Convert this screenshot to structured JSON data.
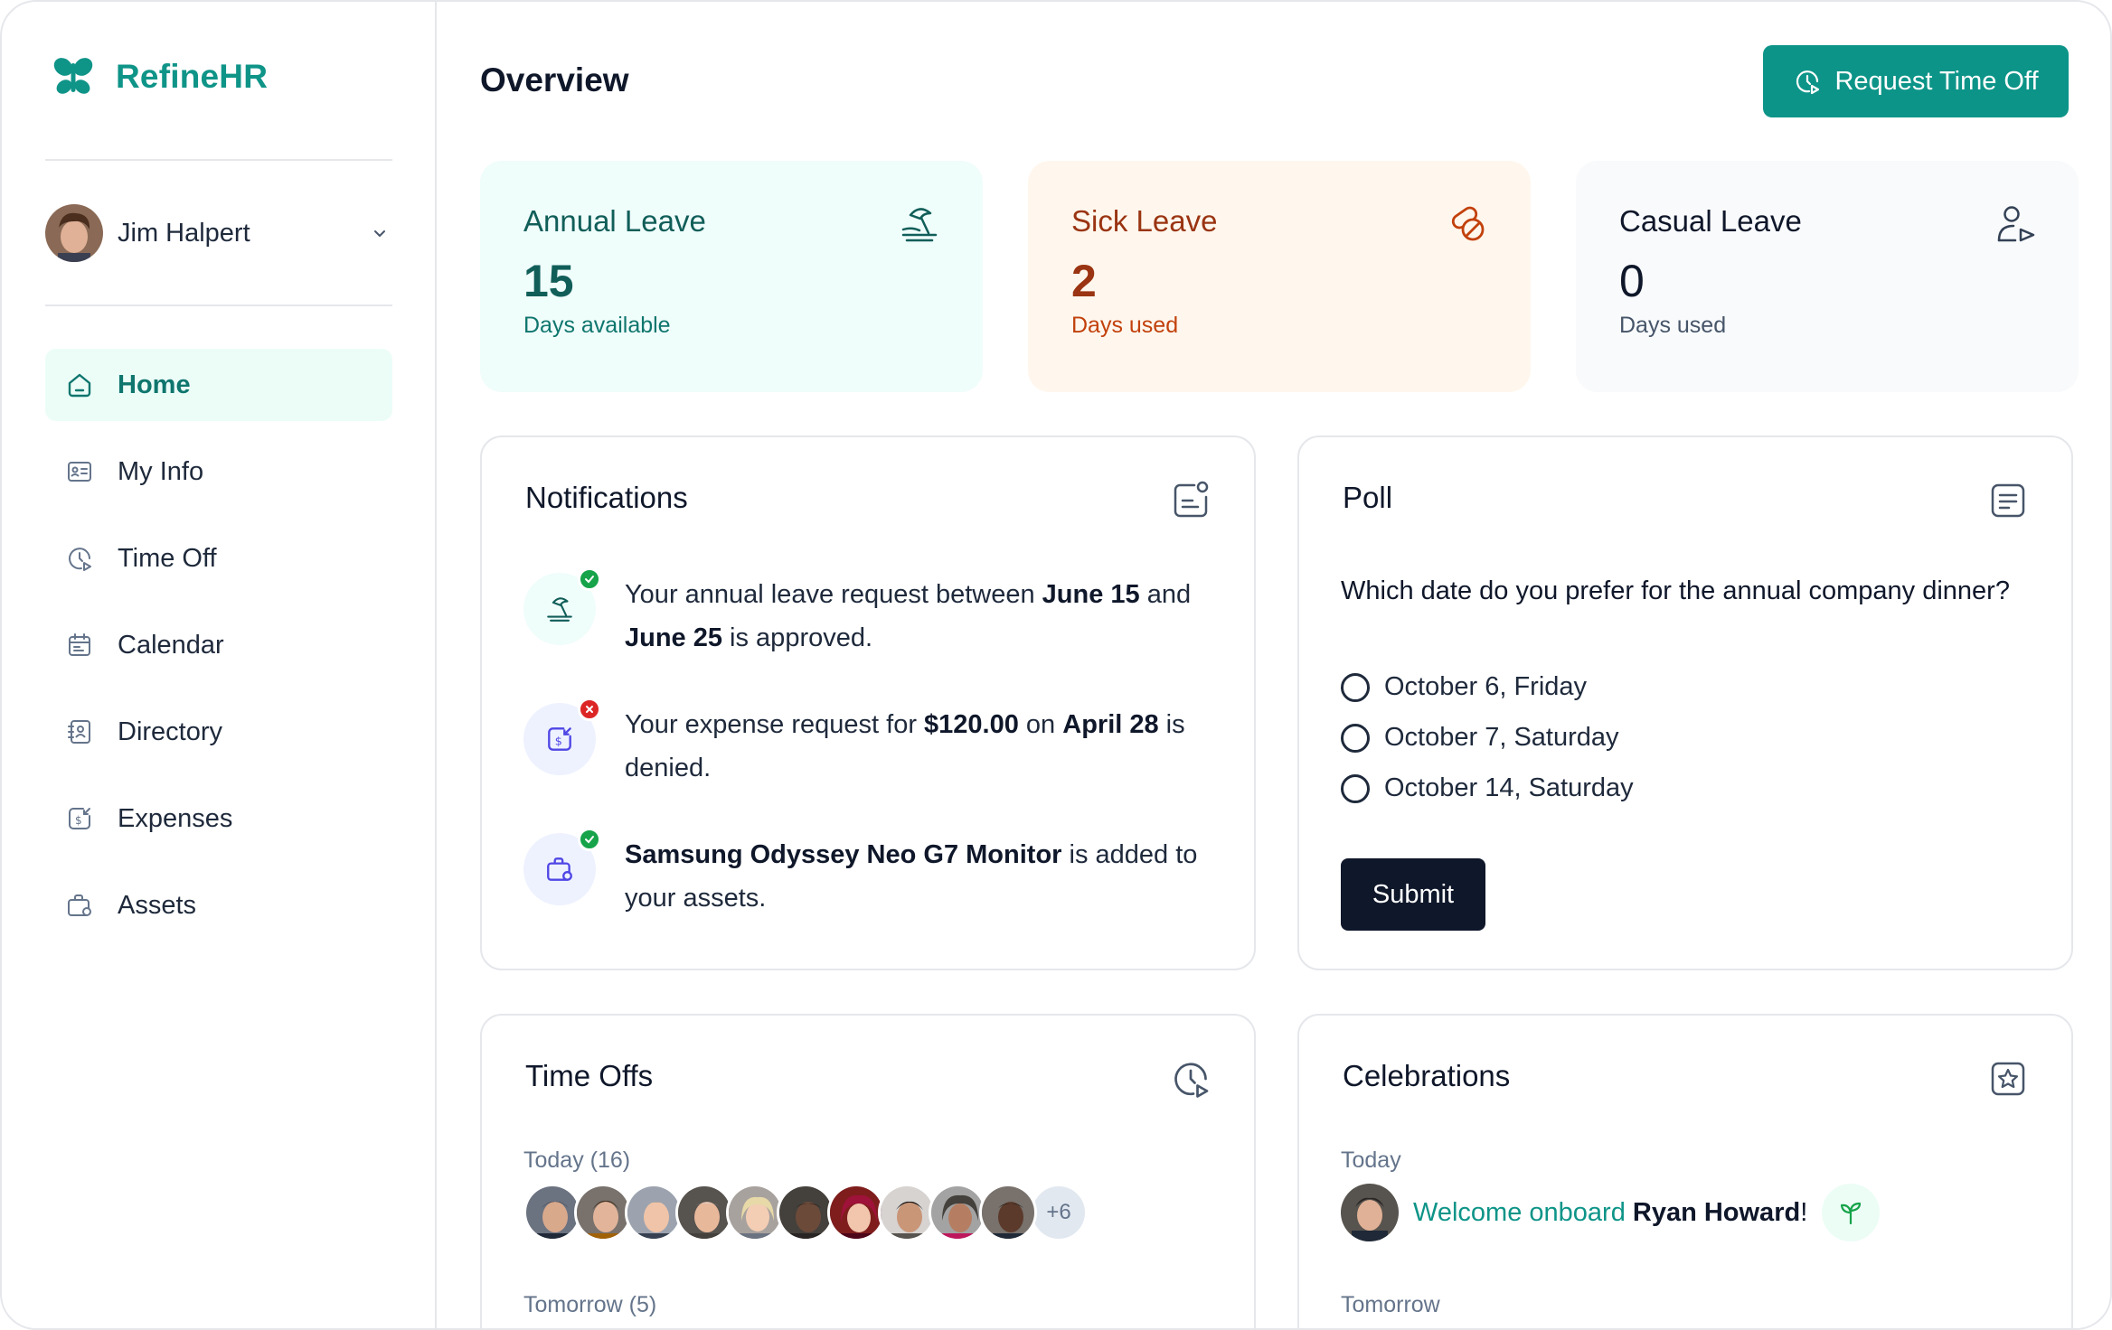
{
  "brand": {
    "name": "RefineHR",
    "color": "#0f9488"
  },
  "user": {
    "name": "Jim Halpert"
  },
  "nav": [
    {
      "label": "Home",
      "icon": "home-icon",
      "active": true
    },
    {
      "label": "My Info",
      "icon": "id-card-icon"
    },
    {
      "label": "Time Off",
      "icon": "clock-icon"
    },
    {
      "label": "Calendar",
      "icon": "calendar-icon"
    },
    {
      "label": "Directory",
      "icon": "contact-book-icon"
    },
    {
      "label": "Expenses",
      "icon": "expense-icon"
    },
    {
      "label": "Assets",
      "icon": "briefcase-icon"
    }
  ],
  "header": {
    "title": "Overview",
    "request_label": "Request Time Off"
  },
  "stats": {
    "annual": {
      "title": "Annual Leave",
      "value": "15",
      "sub": "Days available",
      "icon": "beach-icon",
      "bg": "#effdfb",
      "color": "#115e59"
    },
    "sick": {
      "title": "Sick Leave",
      "value": "2",
      "sub": "Days used",
      "icon": "pills-icon",
      "bg": "#fff7ed",
      "color": "#9a3412"
    },
    "casual": {
      "title": "Casual Leave",
      "value": "0",
      "sub": "Days used",
      "icon": "user-send-icon",
      "bg": "#f8fafc",
      "color": "#0f172a"
    }
  },
  "notifications": {
    "title": "Notifications",
    "items": [
      {
        "parts": [
          "Your annual leave request between ",
          "June 15",
          " and ",
          "June 25",
          " is approved."
        ],
        "status": "approved"
      },
      {
        "parts": [
          "Your expense request for ",
          "$120.00",
          " on ",
          "April 28",
          " is denied."
        ],
        "status": "denied"
      },
      {
        "parts": [
          "",
          "Samsung Odyssey Neo G7 Monitor",
          " is added to your assets."
        ],
        "status": "approved"
      }
    ]
  },
  "poll": {
    "title": "Poll",
    "question": "Which date do you prefer for the annual company dinner?",
    "options": [
      "October 6, Friday",
      "October 7, Saturday",
      "October 14, Saturday"
    ],
    "submit_label": "Submit"
  },
  "timeoffs": {
    "title": "Time Offs",
    "today_label": "Today (16)",
    "more_label": "+6",
    "tomorrow_label": "Tomorrow (5)"
  },
  "celebrations": {
    "title": "Celebrations",
    "today_label": "Today",
    "message_prefix": "Welcome onboard ",
    "person": "Ryan Howard",
    "suffix": "!",
    "tomorrow_label": "Tomorrow"
  }
}
